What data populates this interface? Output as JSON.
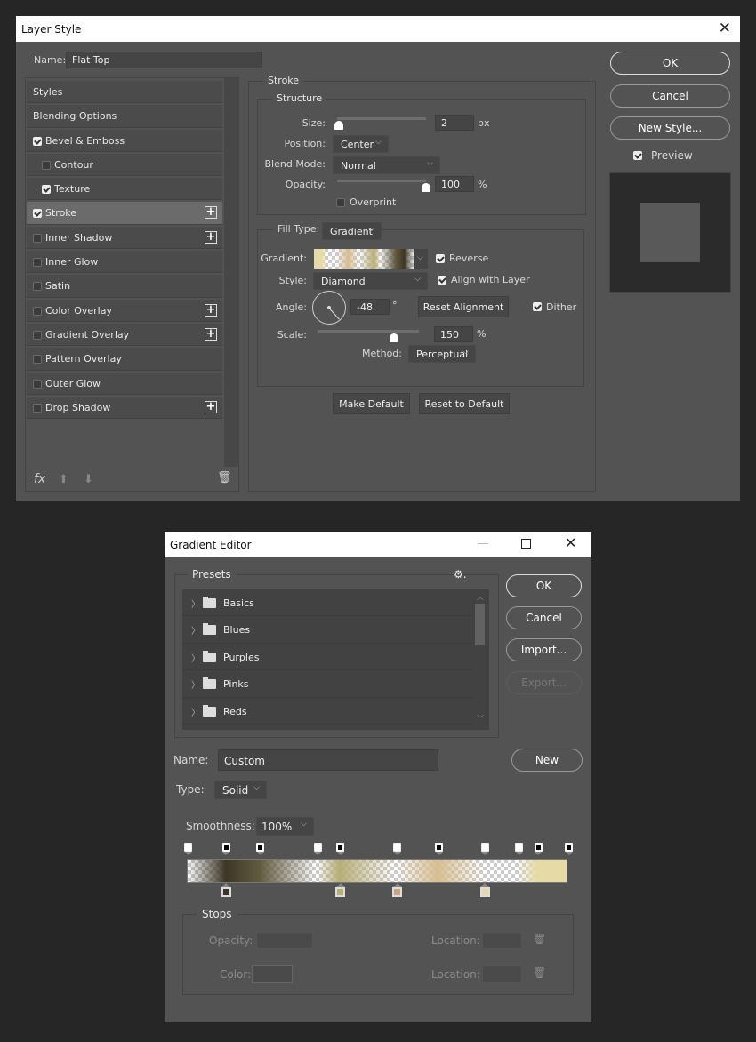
{
  "layer_style": {
    "title": "Layer Style",
    "name_label": "Name:",
    "name_value": "Flat Top",
    "list": [
      {
        "label": "Styles",
        "checkbox": null,
        "plus": false,
        "indent": false
      },
      {
        "label": "Blending Options",
        "checkbox": null,
        "plus": false,
        "indent": false
      },
      {
        "label": "Bevel & Emboss",
        "checkbox": true,
        "plus": false,
        "indent": false
      },
      {
        "label": "Contour",
        "checkbox": false,
        "plus": false,
        "indent": true
      },
      {
        "label": "Texture",
        "checkbox": true,
        "plus": false,
        "indent": true
      },
      {
        "label": "Stroke",
        "checkbox": true,
        "plus": true,
        "indent": false,
        "selected": true
      },
      {
        "label": "Inner Shadow",
        "checkbox": false,
        "plus": true,
        "indent": false
      },
      {
        "label": "Inner Glow",
        "checkbox": false,
        "plus": false,
        "indent": false
      },
      {
        "label": "Satin",
        "checkbox": false,
        "plus": false,
        "indent": false
      },
      {
        "label": "Color Overlay",
        "checkbox": false,
        "plus": true,
        "indent": false
      },
      {
        "label": "Gradient Overlay",
        "checkbox": false,
        "plus": true,
        "indent": false
      },
      {
        "label": "Pattern Overlay",
        "checkbox": false,
        "plus": false,
        "indent": false
      },
      {
        "label": "Outer Glow",
        "checkbox": false,
        "plus": false,
        "indent": false
      },
      {
        "label": "Drop Shadow",
        "checkbox": false,
        "plus": true,
        "indent": false
      }
    ],
    "footer": {
      "fx": "fx"
    },
    "stroke": {
      "title": "Stroke",
      "structure": "Structure",
      "size_label": "Size:",
      "size_value": "2",
      "size_unit": "px",
      "size_slider": 0.02,
      "position_label": "Position:",
      "position_value": "Center",
      "blend_label": "Blend Mode:",
      "blend_value": "Normal",
      "opacity_label": "Opacity:",
      "opacity_value": "100",
      "opacity_unit": "%",
      "opacity_slider": 1.0,
      "overprint": "Overprint",
      "overprint_checked": false,
      "fill_type_label": "Fill Type:",
      "fill_type_value": "Gradient",
      "gradient_label": "Gradient:",
      "reverse": "Reverse",
      "reverse_checked": true,
      "style_label": "Style:",
      "style_value": "Diamond",
      "align": "Align with Layer",
      "align_checked": true,
      "angle_label": "Angle:",
      "angle_value": "-48",
      "angle_unit": "°",
      "reset_alignment": "Reset Alignment",
      "dither": "Dither",
      "dither_checked": true,
      "scale_label": "Scale:",
      "scale_value": "150",
      "scale_unit": "%",
      "scale_slider": 0.75,
      "method_label": "Method:",
      "method_value": "Perceptual",
      "make_default": "Make Default",
      "reset_default": "Reset to Default"
    },
    "buttons": {
      "ok": "OK",
      "cancel": "Cancel",
      "new_style": "New Style...",
      "preview": "Preview",
      "preview_checked": true
    }
  },
  "gradient_editor": {
    "title": "Gradient Editor",
    "presets_label": "Presets",
    "presets": [
      "Basics",
      "Blues",
      "Purples",
      "Pinks",
      "Reds"
    ],
    "buttons": {
      "ok": "OK",
      "cancel": "Cancel",
      "import": "Import...",
      "export": "Export...",
      "new": "New"
    },
    "name_label": "Name:",
    "name_value": "Custom",
    "type_label": "Type:",
    "type_value": "Solid",
    "smoothness_label": "Smoothness:",
    "smoothness_value": "100%",
    "opacity_stops": [
      {
        "location": 0,
        "opacity": 0
      },
      {
        "location": 10,
        "opacity": 100
      },
      {
        "location": 19,
        "opacity": 100
      },
      {
        "location": 34,
        "opacity": 0
      },
      {
        "location": 40,
        "opacity": 100
      },
      {
        "location": 55,
        "opacity": 0
      },
      {
        "location": 66,
        "opacity": 100
      },
      {
        "location": 78,
        "opacity": 0
      },
      {
        "location": 87,
        "opacity": 0
      },
      {
        "location": 92,
        "opacity": 100
      },
      {
        "location": 100,
        "opacity": 100
      }
    ],
    "color_stops": [
      {
        "location": 10,
        "color": "#3d3626"
      },
      {
        "location": 40,
        "color": "#b8ae78"
      },
      {
        "location": 55,
        "color": "#c9a47e"
      },
      {
        "location": 78,
        "color": "#e6dba6"
      }
    ],
    "stops": {
      "title": "Stops",
      "opacity_label": "Opacity:",
      "location_label": "Location:",
      "color_label": "Color:"
    }
  }
}
